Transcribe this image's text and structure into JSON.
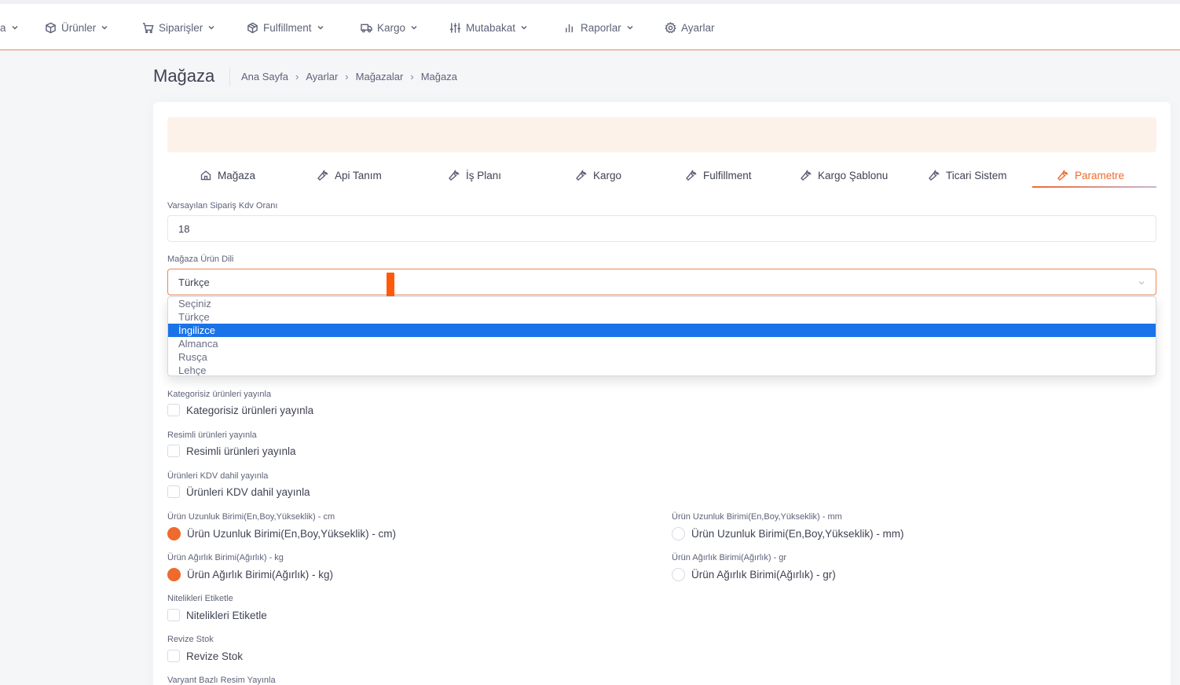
{
  "nav": {
    "items": [
      {
        "label": "a",
        "icon": "chevron-down-icon"
      },
      {
        "label": "Ürünler",
        "icon": "box-icon"
      },
      {
        "label": "Siparişler",
        "icon": "cart-icon"
      },
      {
        "label": "Fulfillment",
        "icon": "cube-icon"
      },
      {
        "label": "Kargo",
        "icon": "truck-icon"
      },
      {
        "label": "Mutabakat",
        "icon": "sliders-icon"
      },
      {
        "label": "Raporlar",
        "icon": "bar-chart-icon"
      },
      {
        "label": "Ayarlar",
        "icon": "gear-icon"
      }
    ]
  },
  "page": {
    "title": "Mağaza",
    "breadcrumb": [
      "Ana Sayfa",
      "Ayarlar",
      "Mağazalar",
      "Mağaza"
    ]
  },
  "tabs": [
    {
      "label": "Mağaza",
      "icon": "home-icon",
      "active": false
    },
    {
      "label": "Api Tanım",
      "icon": "wrench-icon",
      "active": false
    },
    {
      "label": "İş Planı",
      "icon": "wrench-icon",
      "active": false
    },
    {
      "label": "Kargo",
      "icon": "wrench-icon",
      "active": false
    },
    {
      "label": "Fulfillment",
      "icon": "wrench-icon",
      "active": false
    },
    {
      "label": "Kargo Şablonu",
      "icon": "wrench-icon",
      "active": false
    },
    {
      "label": "Ticari Sistem",
      "icon": "wrench-icon",
      "active": false
    },
    {
      "label": "Parametre",
      "icon": "wrench-icon",
      "active": true
    }
  ],
  "form": {
    "kdv": {
      "label": "Varsayılan Sipariş Kdv Oranı",
      "value": "18"
    },
    "language": {
      "label": "Mağaza Ürün Dili",
      "value": "Türkçe",
      "options": [
        "Seçiniz",
        "Türkçe",
        "İngilizce",
        "Almanca",
        "Rusça",
        "Lehçe"
      ],
      "highlighted": "İngilizce"
    },
    "uncategorized": {
      "label": "Kategorisiz ürünleri yayınla",
      "text": "Kategorisiz ürünleri yayınla",
      "checked": false
    },
    "with_images": {
      "label": "Resimli ürünleri yayınla",
      "text": "Resimli ürünleri yayınla",
      "checked": false
    },
    "kdv_included": {
      "label": "Ürünleri KDV dahil yayınla",
      "text": "Ürünleri KDV dahil yayınla",
      "checked": false
    },
    "length_unit": {
      "cm": {
        "label": "Ürün Uzunluk Birimi(En,Boy,Yükseklik) - cm",
        "text": "Ürün Uzunluk Birimi(En,Boy,Yükseklik) - cm)",
        "selected": true
      },
      "mm": {
        "label": "Ürün Uzunluk Birimi(En,Boy,Yükseklik) - mm",
        "text": "Ürün Uzunluk Birimi(En,Boy,Yükseklik) - mm)",
        "selected": false
      }
    },
    "weight_unit": {
      "kg": {
        "label": "Ürün Ağırlık Birimi(Ağırlık) - kg",
        "text": "Ürün Ağırlık Birimi(Ağırlık) - kg)",
        "selected": true
      },
      "gr": {
        "label": "Ürün Ağırlık Birimi(Ağırlık) - gr",
        "text": "Ürün Ağırlık Birimi(Ağırlık) - gr)",
        "selected": false
      }
    },
    "tag_attributes": {
      "label": "Nitelikleri Etiketle",
      "text": "Nitelikleri Etiketle",
      "checked": false
    },
    "revise_stock": {
      "label": "Revize Stok",
      "text": "Revize Stok",
      "checked": false
    },
    "variant_image": {
      "label": "Varyant Bazlı Resim Yayınla"
    }
  },
  "colors": {
    "accent": "#ee6a2d",
    "highlight": "#1a73e8"
  }
}
